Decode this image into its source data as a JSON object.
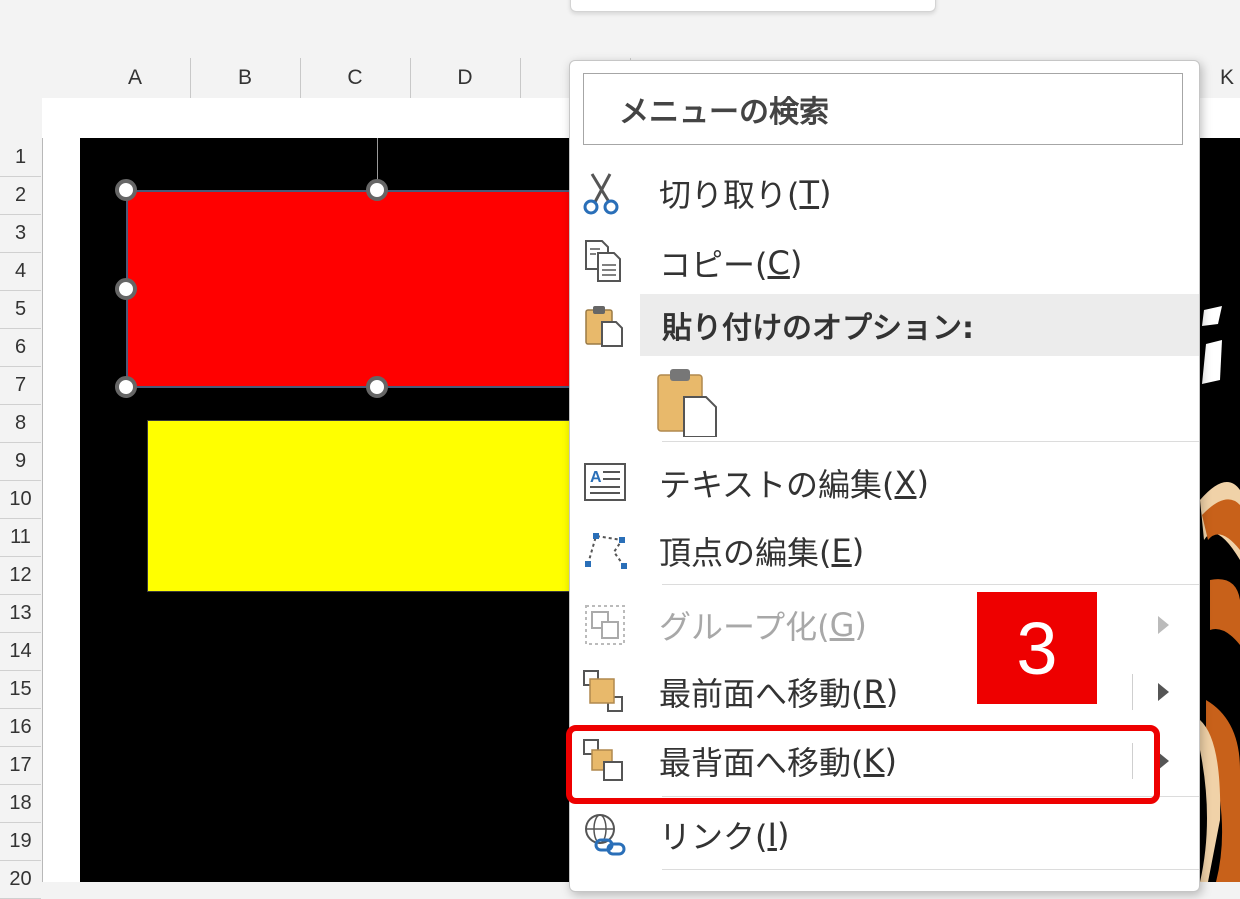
{
  "sheet": {
    "columns": [
      "A",
      "B",
      "C",
      "D",
      "K"
    ],
    "rows": [
      "1",
      "2",
      "3",
      "4",
      "5",
      "6",
      "7",
      "8",
      "9",
      "10",
      "11",
      "12",
      "13",
      "14",
      "15",
      "16",
      "17",
      "18",
      "19",
      "20"
    ]
  },
  "colors": {
    "red_shape": "#ff0000",
    "yellow_shape": "#ffff00",
    "background_panel": "#000000",
    "accent": "#ee0000"
  },
  "context_menu": {
    "search_placeholder": "メニューの検索",
    "items": [
      {
        "label_text": "切り取り(",
        "mnemonic": "T",
        "label_end": ")",
        "icon": "scissors-icon",
        "enabled": true
      },
      {
        "label_text": "コピー(",
        "mnemonic": "C",
        "label_end": ")",
        "icon": "copy-icon",
        "enabled": true
      },
      {
        "label_text": "貼り付けのオプション:",
        "icon": "paste-options-icon",
        "header": true
      },
      {
        "icon": "paste-keep-format-icon",
        "enabled": true
      },
      {
        "label_text": "テキストの編集(",
        "mnemonic": "X",
        "label_end": ")",
        "icon": "edit-text-icon",
        "enabled": true
      },
      {
        "label_text": "頂点の編集(",
        "mnemonic": "E",
        "label_end": ")",
        "icon": "edit-points-icon",
        "enabled": true
      },
      {
        "label_text": "グループ化(",
        "mnemonic": "G",
        "label_end": ")",
        "icon": "group-icon",
        "enabled": false,
        "submenu": true
      },
      {
        "label_text": "最前面へ移動(",
        "mnemonic": "R",
        "label_end": ")",
        "icon": "bring-to-front-icon",
        "enabled": true,
        "submenu": true
      },
      {
        "label_text": "最背面へ移動(",
        "mnemonic": "K",
        "label_end": ")",
        "icon": "send-to-back-icon",
        "enabled": true,
        "submenu": true,
        "highlighted": true
      },
      {
        "label_text": "リンク(",
        "mnemonic": "I",
        "label_end": ")",
        "icon": "link-icon",
        "enabled": true
      }
    ]
  },
  "annotation": {
    "step_number": "3"
  }
}
